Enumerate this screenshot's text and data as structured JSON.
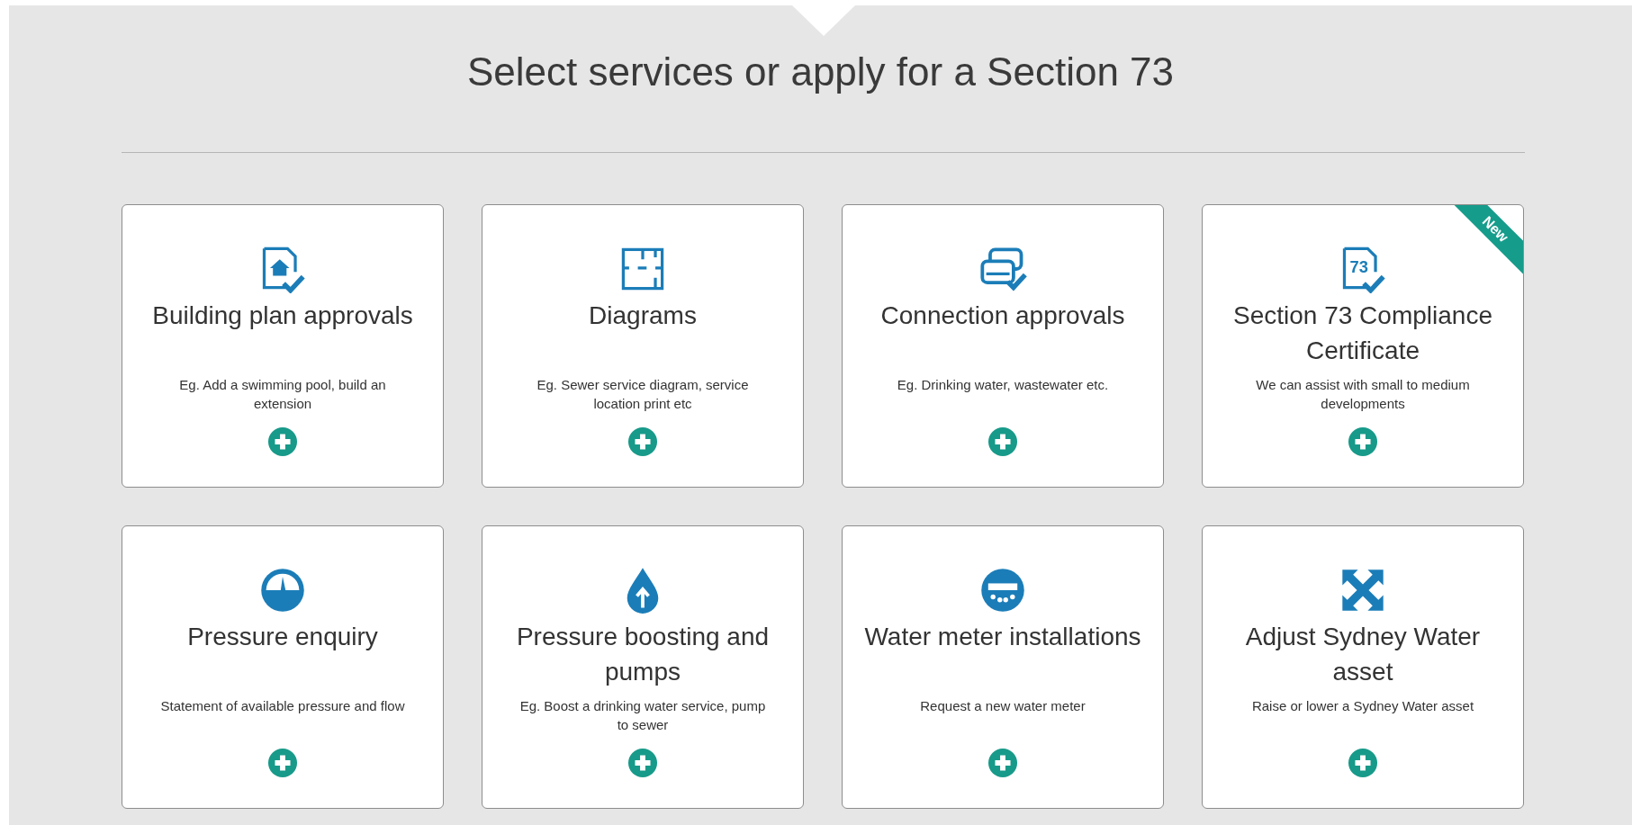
{
  "heading": "Select services or apply for a Section 73",
  "services": [
    {
      "kind": "house-doc",
      "title": "Building plan approvals",
      "description": "Eg. Add a swimming pool, build an extension"
    },
    {
      "kind": "floorplan",
      "title": "Diagrams",
      "description": "Eg. Sewer service diagram, service location print etc"
    },
    {
      "kind": "connection",
      "title": "Connection approvals",
      "description": "Eg. Drinking water, wastewater etc."
    },
    {
      "kind": "numbered-doc",
      "icon_text": "73",
      "title": "Section 73 Compliance Certificate",
      "description": "We can assist with small to medium developments",
      "badge": "New"
    },
    {
      "kind": "gauge",
      "title": "Pressure enquiry",
      "description": "Statement of available pressure and flow"
    },
    {
      "kind": "drop",
      "title": "Pressure boosting and pumps",
      "description": "Eg. Boost a drinking water service, pump to sewer"
    },
    {
      "kind": "meter",
      "title": "Water meter installations",
      "description": "Request a new water meter"
    },
    {
      "kind": "arrows",
      "title": "Adjust Sydney Water asset",
      "description": "Raise or lower a Sydney Water asset"
    }
  ]
}
